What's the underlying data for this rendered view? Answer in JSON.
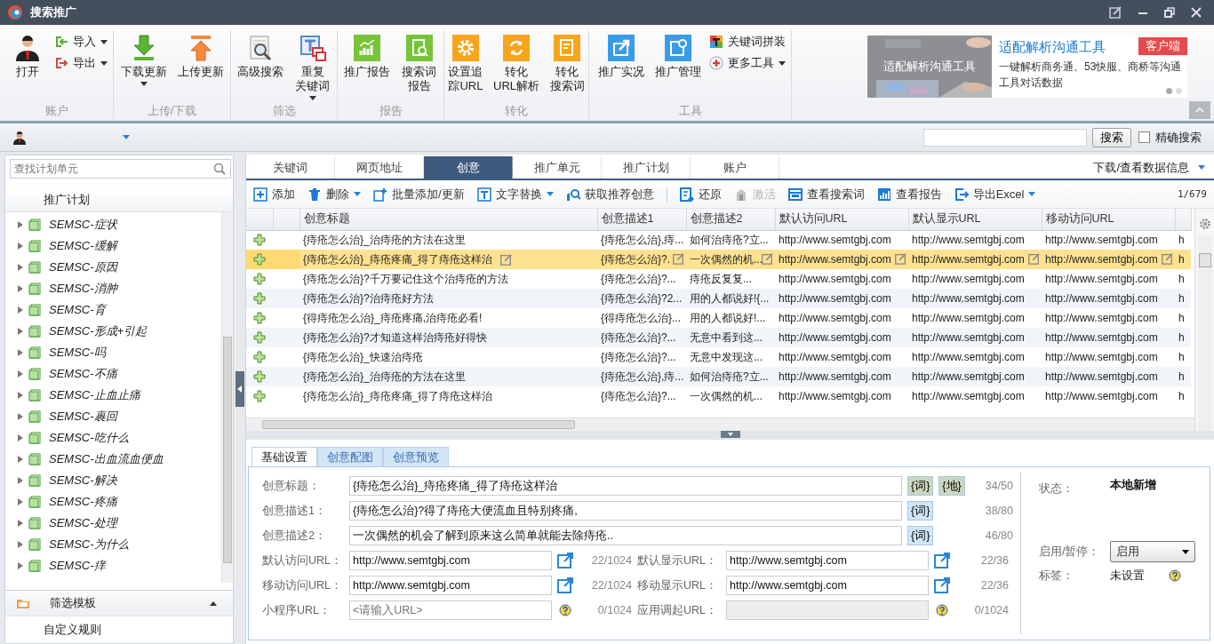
{
  "window": {
    "title": "搜索推广"
  },
  "ribbon": {
    "groups": [
      {
        "label": "账户",
        "items": [
          {
            "label": "打开",
            "kind": "large",
            "dropdown": false
          },
          {
            "label": "导入",
            "kind": "small",
            "dropdown": true
          },
          {
            "label": "导出",
            "kind": "small",
            "dropdown": true
          }
        ]
      },
      {
        "label": "上传/下载",
        "items": [
          {
            "label": "下载更新",
            "kind": "large",
            "dropdown": true
          },
          {
            "label": "上传更新",
            "kind": "large",
            "dropdown": false
          }
        ]
      },
      {
        "label": "筛选",
        "items": [
          {
            "label": "高级搜索",
            "kind": "large",
            "dropdown": false
          },
          {
            "lines": [
              "重复",
              "关键词"
            ],
            "kind": "large",
            "dropdown": true
          }
        ]
      },
      {
        "label": "报告",
        "items": [
          {
            "label": "推广报告",
            "kind": "large",
            "dropdown": false
          },
          {
            "lines": [
              "搜索词",
              "报告"
            ],
            "kind": "large",
            "dropdown": false
          }
        ]
      },
      {
        "label": "转化",
        "items": [
          {
            "lines": [
              "设置追",
              "踪URL"
            ],
            "kind": "large",
            "dropdown": false
          },
          {
            "lines": [
              "转化",
              "URL解析"
            ],
            "kind": "large",
            "dropdown": false
          },
          {
            "lines": [
              "转化",
              "搜索词"
            ],
            "kind": "large",
            "dropdown": false
          }
        ]
      },
      {
        "label": "工具",
        "items": [
          {
            "label": "推广实况",
            "kind": "large",
            "dropdown": false
          },
          {
            "label": "推广管理",
            "kind": "large",
            "dropdown": false
          },
          {
            "label": "关键词拼装",
            "kind": "small",
            "dropdown": false
          },
          {
            "label": "更多工具",
            "kind": "small",
            "dropdown": true
          }
        ]
      }
    ],
    "banner": {
      "image_caption": "适配解析沟通工具",
      "title": "适配解析沟通工具",
      "badge": "客户端",
      "text": "一键解析商务通、53快服、商桥等沟通工具对话数据",
      "slides": [
        {
          "selected": true
        },
        {
          "selected": false
        }
      ]
    }
  },
  "account_bar": {
    "search_button": "搜索",
    "exact_search": {
      "label": "精确搜索",
      "checked": false
    }
  },
  "sidebar": {
    "search_placeholder": "查找计划单元",
    "header": "推广计划",
    "plans": [
      {
        "name": "SEMSC-症状"
      },
      {
        "name": "SEMSC-缓解"
      },
      {
        "name": "SEMSC-原因"
      },
      {
        "name": "SEMSC-消肿"
      },
      {
        "name": "SEMSC-育"
      },
      {
        "name": "SEMSC-形成+引起"
      },
      {
        "name": "SEMSC-吗"
      },
      {
        "name": "SEMSC-不痛"
      },
      {
        "name": "SEMSC-止血止痛"
      },
      {
        "name": "SEMSC-裹回"
      },
      {
        "name": "SEMSC-吃什么"
      },
      {
        "name": "SEMSC-出血流血便血"
      },
      {
        "name": "SEMSC-解决"
      },
      {
        "name": "SEMSC-疼痛"
      },
      {
        "name": "SEMSC-处理"
      },
      {
        "name": "SEMSC-为什么"
      },
      {
        "name": "SEMSC-痒"
      }
    ],
    "filter_panel": "筛选模板",
    "custom_rule": "自定义规则"
  },
  "tabs": [
    {
      "label": "关键词",
      "selected": false
    },
    {
      "label": "网页地址",
      "selected": false
    },
    {
      "label": "创意",
      "selected": true
    },
    {
      "label": "推广单元",
      "selected": false
    },
    {
      "label": "推广计划",
      "selected": false
    },
    {
      "label": "账户",
      "selected": false
    }
  ],
  "data_menu": "下载/查看数据信息",
  "toolbar": {
    "groups": [
      [
        {
          "label": "添加",
          "dropdown": false,
          "disabled": false
        },
        {
          "label": "删除",
          "dropdown": true,
          "disabled": false
        },
        {
          "label": "批量添加/更新",
          "dropdown": false,
          "disabled": false
        },
        {
          "label": "文字替换",
          "dropdown": true,
          "disabled": false
        },
        {
          "label": "获取推荐创意",
          "dropdown": false,
          "disabled": false
        }
      ],
      [
        {
          "label": "还原",
          "dropdown": false,
          "disabled": false
        },
        {
          "label": "激活",
          "dropdown": false,
          "disabled": true
        },
        {
          "label": "查看搜索词",
          "dropdown": false,
          "disabled": false
        },
        {
          "label": "查看报告",
          "dropdown": false,
          "disabled": false
        },
        {
          "label": "导出Excel",
          "dropdown": true,
          "disabled": false
        }
      ]
    ],
    "page": "1/679"
  },
  "table": {
    "columns": [
      "创意标题",
      "创意描述1",
      "创意描述2",
      "默认访问URL",
      "默认显示URL",
      "移动访问URL"
    ],
    "rows": [
      {
        "selected": false,
        "cells": [
          "{痔疮怎么治}_治痔疮的方法在这里",
          "{痔疮怎么治},痔...",
          "如何治痔疮?立...",
          "http://www.semtgbj.com",
          "http://www.semtgbj.com",
          "http://www.semtgbj.com",
          "h"
        ]
      },
      {
        "selected": true,
        "cells": [
          "{痔疮怎么治}_痔疮疼痛_得了痔疮这样治",
          "{痔疮怎么治}?.",
          "一次偶然的机...",
          "http://www.semtgbj.com",
          "http://www.semtgbj.com",
          "http://www.semtgbj.com",
          "h"
        ]
      },
      {
        "selected": false,
        "cells": [
          "{痔疮怎么治}?千万要记住这个治痔疮的方法",
          "{痔疮怎么治}?...",
          "痔疮反复复...",
          "http://www.semtgbj.com",
          "http://www.semtgbj.com",
          "http://www.semtgbj.com",
          "h"
        ]
      },
      {
        "selected": false,
        "cells": [
          "{痔疮怎么治}?治痔疮好方法",
          "{痔疮怎么治}?2...",
          "用的人都说好!{...",
          "http://www.semtgbj.com",
          "http://www.semtgbj.com",
          "http://www.semtgbj.com",
          "h"
        ]
      },
      {
        "selected": false,
        "cells": [
          "{得痔疮怎么治}_痔疮疼痛,治痔疮必看!",
          "{得痔疮怎么治}...",
          "用的人都说好!...",
          "http://www.semtgbj.com",
          "http://www.semtgbj.com",
          "http://www.semtgbj.com",
          "h"
        ]
      },
      {
        "selected": false,
        "cells": [
          "{痔疮怎么治}?才知道这样治痔疮好得快",
          "{痔疮怎么治}?...",
          "无意中看到这...",
          "http://www.semtgbj.com",
          "http://www.semtgbj.com",
          "http://www.semtgbj.com",
          "h"
        ]
      },
      {
        "selected": false,
        "cells": [
          "{痔疮怎么治}_快速治痔疮",
          "{痔疮怎么治}?...",
          "无意中发现这...",
          "http://www.semtgbj.com",
          "http://www.semtgbj.com",
          "http://www.semtgbj.com",
          "h"
        ]
      },
      {
        "selected": false,
        "cells": [
          "{痔疮怎么治}_治痔疮的方法在这里",
          "{痔疮怎么治},痔...",
          "如何治痔疮?立...",
          "http://www.semtgbj.com",
          "http://www.semtgbj.com",
          "http://www.semtgbj.com",
          "h"
        ]
      },
      {
        "selected": false,
        "cells": [
          "{痔疮怎么治}_痔疮疼痛_得了痔疮这样治",
          "{痔疮怎么治}?...",
          "一次偶然的机...",
          "http://www.semtgbj.com",
          "http://www.semtgbj.com",
          "http://www.semtgbj.com",
          "h"
        ]
      }
    ]
  },
  "editor": {
    "tabs": [
      {
        "label": "基础设置",
        "selected": true
      },
      {
        "label": "创意配图",
        "selected": false
      },
      {
        "label": "创意预览",
        "selected": false
      }
    ],
    "text_fields": [
      {
        "label": "创意标题：",
        "value": "{痔疮怎么治}_痔疮疼痛_得了痔疮这样治",
        "tokens": [
          {
            "label": "{词}",
            "selected": true
          },
          {
            "label": "{地}",
            "selected": true
          }
        ],
        "count": "34/50"
      },
      {
        "label": "创意描述1：",
        "value": "{痔疮怎么治}?得了痔疮大便流血且特别疼痛,",
        "tokens": [
          {
            "label": "{词}",
            "selected": false
          }
        ],
        "count": "38/80"
      },
      {
        "label": "创意描述2：",
        "value": "一次偶然的机会了解到原来这么简单就能去除痔疮..",
        "tokens": [
          {
            "label": "{词}",
            "selected": false
          }
        ],
        "count": "46/80"
      }
    ],
    "url_rows": [
      [
        {
          "label": "默认访问URL：",
          "value": "http://www.semtgbj.com",
          "kind": "link",
          "disabled": false,
          "count": "22/1024"
        },
        {
          "label": "默认显示URL：",
          "value": "http://www.semtgbj.com",
          "kind": "link",
          "disabled": false,
          "count": "22/36"
        }
      ],
      [
        {
          "label": "移动访问URL：",
          "value": "http://www.semtgbj.com",
          "kind": "link",
          "disabled": false,
          "count": "22/1024"
        },
        {
          "label": "移动显示URL：",
          "value": "http://www.semtgbj.com",
          "kind": "link",
          "disabled": false,
          "count": "22/36"
        }
      ],
      [
        {
          "label": "小程序URL：",
          "placeholder": "<请输入URL>",
          "kind": "help",
          "disabled": false,
          "count": "0/1024"
        },
        {
          "label": "应用调起URL：",
          "kind": "help",
          "disabled": true,
          "count": "0/1024"
        }
      ]
    ],
    "status": {
      "label": "状态：",
      "value": "本地新增"
    },
    "enable": {
      "label": "启用/暂停：",
      "value": "启用"
    },
    "tag": {
      "label": "标签：",
      "value": "未设置"
    }
  }
}
